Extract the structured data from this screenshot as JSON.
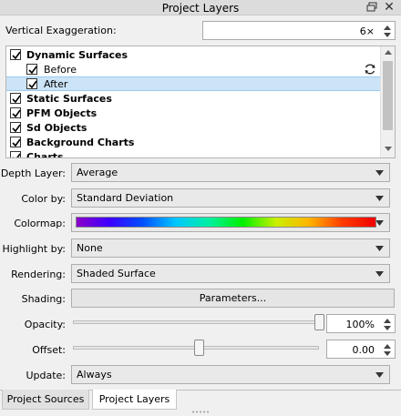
{
  "window": {
    "title": "Project Layers"
  },
  "vertical_exaggeration": {
    "label": "Vertical Exaggeration:",
    "value": "6×"
  },
  "tree": {
    "items": [
      {
        "label": "Dynamic Surfaces",
        "checked": true,
        "bold": true
      },
      {
        "label": "Before",
        "checked": true,
        "bold": false,
        "has_refresh_icon": true
      },
      {
        "label": "After",
        "checked": true,
        "bold": false,
        "selected": true
      },
      {
        "label": "Static Surfaces",
        "checked": true,
        "bold": true
      },
      {
        "label": "PFM Objects",
        "checked": true,
        "bold": true
      },
      {
        "label": "Sd Objects",
        "checked": true,
        "bold": true
      },
      {
        "label": "Background Charts",
        "checked": true,
        "bold": true
      },
      {
        "label": "Charts",
        "checked": true,
        "bold": true
      }
    ]
  },
  "form": {
    "depth_layer": {
      "label": "Depth Layer:",
      "value": "Average"
    },
    "color_by": {
      "label": "Color by:",
      "value": "Standard Deviation"
    },
    "colormap": {
      "label": "Colormap:"
    },
    "highlight_by": {
      "label": "Highlight by:",
      "value": "None"
    },
    "rendering": {
      "label": "Rendering:",
      "value": "Shaded Surface"
    },
    "shading": {
      "label": "Shading:",
      "button": "Parameters..."
    },
    "opacity": {
      "label": "Opacity:",
      "value": "100%",
      "level": 1.0
    },
    "offset": {
      "label": "Offset:",
      "value": "0.00",
      "level": 0.5
    },
    "update": {
      "label": "Update:",
      "value": "Always"
    }
  },
  "tabs": [
    {
      "label": "Project Sources",
      "active": false
    },
    {
      "label": "Project Layers",
      "active": true
    }
  ]
}
